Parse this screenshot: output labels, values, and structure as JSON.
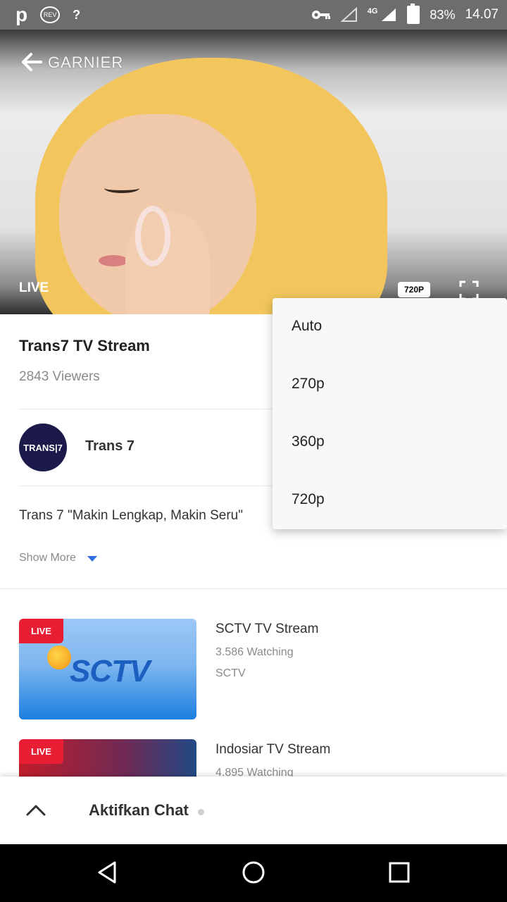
{
  "status_bar": {
    "left_icons": [
      "p-icon",
      "rev-icon",
      "signal-unknown-icon"
    ],
    "p_text": "p",
    "rev_text": "REV",
    "q_text": "?",
    "network": "4G",
    "battery": "83%",
    "time": "14.07"
  },
  "video": {
    "brand_overlay": "GARNIER",
    "live_label": "LIVE",
    "quality_badge": "720P"
  },
  "stream": {
    "title": "Trans7 TV Stream",
    "viewers": "2843 Viewers"
  },
  "channel": {
    "logo_text": "TRANS|7",
    "name": "Trans 7"
  },
  "description": "Trans 7 \"Makin Lengkap, Makin Seru\"",
  "show_more": "Show More",
  "quality_menu": {
    "options": [
      "Auto",
      "270p",
      "360p",
      "720p"
    ]
  },
  "related": [
    {
      "badge": "LIVE",
      "title": "SCTV TV Stream",
      "watching": "3.586 Watching",
      "channel": "SCTV",
      "logo_text": "SCTV"
    },
    {
      "badge": "LIVE",
      "title": "Indosiar TV Stream",
      "watching": "4.895 Watching"
    }
  ],
  "chat": {
    "label": "Aktifkan Chat"
  },
  "colors": {
    "live_badge": "#e81e35",
    "accent": "#2f6fe0",
    "channel_logo_bg": "#1c1a4a"
  }
}
